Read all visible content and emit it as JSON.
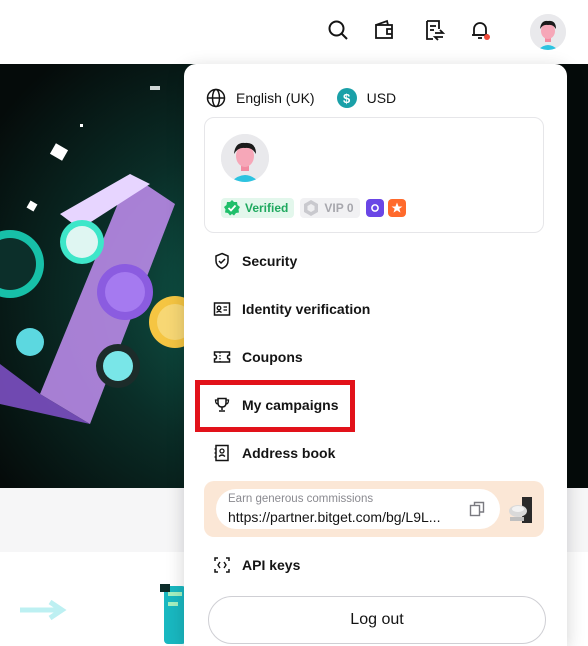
{
  "header": {
    "icons": [
      "search-icon",
      "wallet-icon",
      "orders-icon",
      "bell-icon",
      "avatar"
    ]
  },
  "prefs": {
    "language": "English (UK)",
    "currency_symbol": "$",
    "currency": "USD"
  },
  "user": {
    "verified_label": "Verified",
    "vip_label": "VIP 0"
  },
  "menu": {
    "security": "Security",
    "identity": "Identity verification",
    "coupons": "Coupons",
    "campaigns": "My campaigns",
    "address_book": "Address book",
    "api_keys": "API keys"
  },
  "referral": {
    "hint": "Earn generous commissions",
    "link": "https://partner.bitget.com/bg/L9L..."
  },
  "logout_label": "Log out",
  "colors": {
    "accent_highlight": "#e2121a",
    "verified_green": "#1fa95f",
    "usd_teal": "#1aa0a8",
    "referral_bg": "#fbe7d6"
  }
}
